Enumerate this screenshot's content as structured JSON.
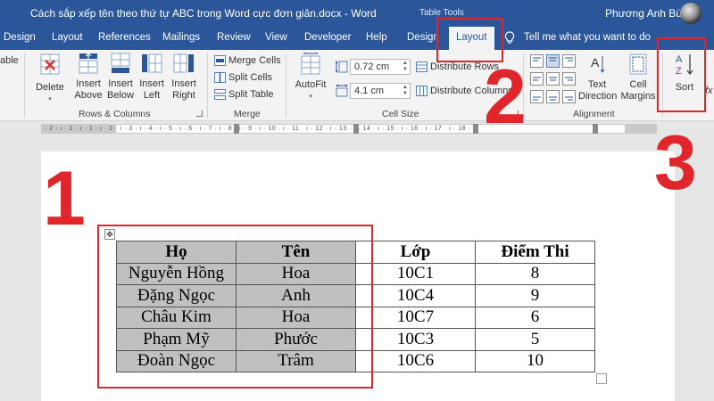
{
  "titlebar": {
    "document_title": "Cách sắp xếp tên theo thứ tự ABC trong Word cực đơn giản.docx  -  Word",
    "context_label": "Table Tools",
    "user_name": "Phương Anh Bùi"
  },
  "tabs": [
    "Design",
    "Layout",
    "References",
    "Mailings",
    "Review",
    "View",
    "Developer",
    "Help",
    "Design",
    "Layout"
  ],
  "active_tab": "Layout",
  "tell_me": "Tell me what you want to do",
  "ribbon": {
    "partial_left_label": "able",
    "delete_label": "Delete",
    "insert_above": [
      "Insert",
      "Above"
    ],
    "insert_below": [
      "Insert",
      "Below"
    ],
    "insert_left": [
      "Insert",
      "Left"
    ],
    "insert_right": [
      "Insert",
      "Right"
    ],
    "rows_columns_group": "Rows & Columns",
    "merge_cells": "Merge Cells",
    "split_cells": "Split Cells",
    "split_table": "Split Table",
    "merge_group": "Merge",
    "autofit": "AutoFit",
    "height_value": "0.72 cm",
    "width_value": "4.1 cm",
    "distribute_rows": "Distribute Rows",
    "distribute_columns": "Distribute Columns",
    "cell_size_group": "Cell Size",
    "text_direction": [
      "Text",
      "Direction"
    ],
    "cell_margins": [
      "Cell",
      "Margins"
    ],
    "alignment_group": "Alignment",
    "sort_label": "Sort",
    "fx_label": "fx"
  },
  "ruler_marks": "· 2 · ı · 1 · ı · 1 · ı · 2 · ı · 3 · ı · 4 · ı · 5 · ı · 6 · ı · 7 · ı · 8 · ı · 9 · ı · 10 · ı · 11 · ı · 12 · ı · 13 · ı · 14 · ı · 15 · ı · 16 · ı · 17 · ı · 18 · ı",
  "table": {
    "headers": [
      "Họ",
      "Tên",
      "Lớp",
      "Điểm Thi"
    ],
    "rows": [
      [
        "Nguyễn Hồng",
        "Hoa",
        "10C1",
        "8"
      ],
      [
        "Đặng Ngọc",
        "Anh",
        "10C4",
        "9"
      ],
      [
        "Châu Kim",
        "Hoa",
        "10C7",
        "6"
      ],
      [
        "Phạm Mỹ",
        "Phước",
        "10C3",
        "5"
      ],
      [
        "Đoàn Ngọc",
        "Trâm",
        "10C6",
        "10"
      ]
    ]
  },
  "annotations": [
    "1",
    "2",
    "3"
  ],
  "colors": {
    "accent": "#2b579a",
    "annotation_red": "#e0252b",
    "selection_grey": "#c0c0c0"
  },
  "icons": [
    "delete-icon",
    "insert-above-icon",
    "insert-below-icon",
    "insert-left-icon",
    "insert-right-icon",
    "merge-cells-icon",
    "split-cells-icon",
    "split-table-icon",
    "autofit-icon",
    "height-icon",
    "width-icon",
    "distribute-rows-icon",
    "distribute-columns-icon",
    "align-icon",
    "text-direction-icon",
    "cell-margins-icon",
    "sort-icon",
    "lightbulb-icon",
    "table-move-icon"
  ]
}
